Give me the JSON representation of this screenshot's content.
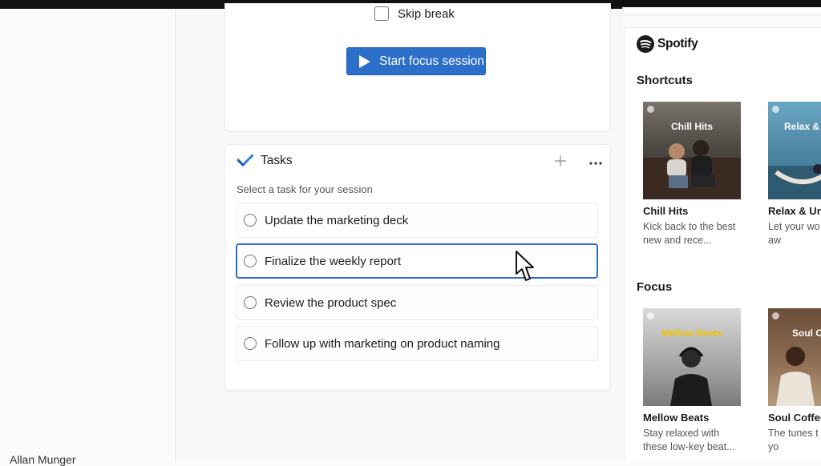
{
  "timer": {
    "skip_break_label": "Skip break",
    "start_button_label": "Start focus session"
  },
  "tasks": {
    "title": "Tasks",
    "subtitle": "Select a task for your session",
    "items": [
      {
        "label": "Update the marketing deck",
        "selected": false
      },
      {
        "label": "Finalize the weekly report",
        "selected": true
      },
      {
        "label": "Review the product spec",
        "selected": false
      },
      {
        "label": "Follow up with marketing on product naming",
        "selected": false
      }
    ]
  },
  "user": {
    "name": "Allan Munger"
  },
  "spotify": {
    "brand": "Spotify",
    "brand_color": "#1b1b1b",
    "shortcuts_title": "Shortcuts",
    "focus_title": "Focus",
    "shortcuts": [
      {
        "art_title": "Chill Hits",
        "title": "Chill Hits",
        "desc": "Kick back to the best new and rece..."
      },
      {
        "art_title": "Relax & U",
        "title": "Relax & Unw",
        "desc": "Let your wo cares slip aw"
      }
    ],
    "focus": [
      {
        "art_title": "Mellow Beats",
        "title": "Mellow  Beats",
        "desc": "Stay relaxed with these low-key beat..."
      },
      {
        "art_title": "Soul Co",
        "title": "Soul Coffee",
        "desc": "The tunes t you into yo"
      }
    ]
  },
  "colors": {
    "accent": "#2c6fc8",
    "tasks_icon": "#2f7de1"
  }
}
